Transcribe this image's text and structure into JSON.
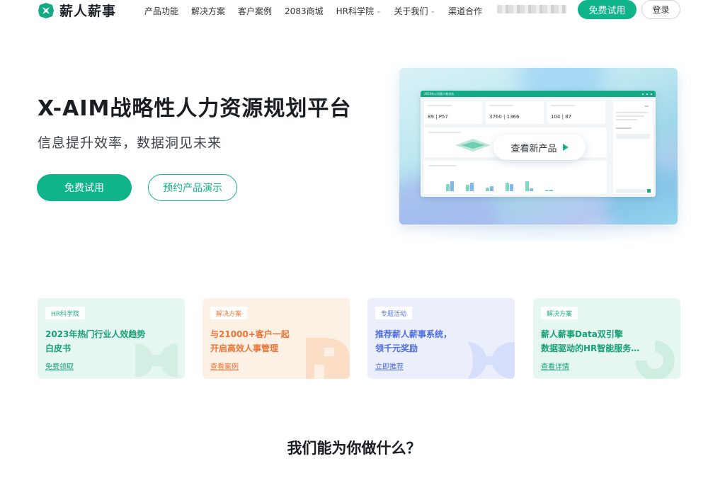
{
  "brand": {
    "name": "薪人薪事",
    "logo_icon": "xinren-logo-icon",
    "accent": "#0fb48a"
  },
  "nav": {
    "items": [
      {
        "label": "产品功能",
        "has_dropdown": false
      },
      {
        "label": "解决方案",
        "has_dropdown": false
      },
      {
        "label": "客户案例",
        "has_dropdown": false
      },
      {
        "label": "2083商城",
        "has_dropdown": false
      },
      {
        "label": "HR科学院",
        "has_dropdown": true
      },
      {
        "label": "关于我们",
        "has_dropdown": true
      },
      {
        "label": "渠道合作",
        "has_dropdown": false
      }
    ],
    "trial_button": "免费试用",
    "login_button": "登录"
  },
  "hero": {
    "title": "X-AIM战略性人力资源规划平台",
    "subtitle": "信息提升效率，数据洞见未来",
    "trial_button": "免费试用",
    "demo_button": "预约产品演示",
    "preview": {
      "overlay_label": "查看新产品",
      "dashboard_title": "2023年公司晋人效分析",
      "kpis": [
        {
          "value": "89 | P57"
        },
        {
          "value": "3760 | 1366"
        },
        {
          "value": "104 | 87"
        }
      ]
    }
  },
  "cards": [
    {
      "tag": "HR科学院",
      "title_line1": "2023年热门行业人效趋势",
      "title_line2": "白皮书",
      "link": "免费领取"
    },
    {
      "tag": "解决方案",
      "title_line1": "与21000+客户一起",
      "title_line2": "开启高效人事管理",
      "link": "查看案例"
    },
    {
      "tag": "专题活动",
      "title_line1": "推荐薪人薪事系统，",
      "title_line2": "领千元奖励",
      "link": "立即推荐"
    },
    {
      "tag": "解决方案",
      "title_line1": "薪人薪事Data双引擎",
      "title_line2": "数据驱动的HR智能服务…",
      "link": "查看详情"
    }
  ],
  "section": {
    "title": "我们能为你做什么？"
  }
}
